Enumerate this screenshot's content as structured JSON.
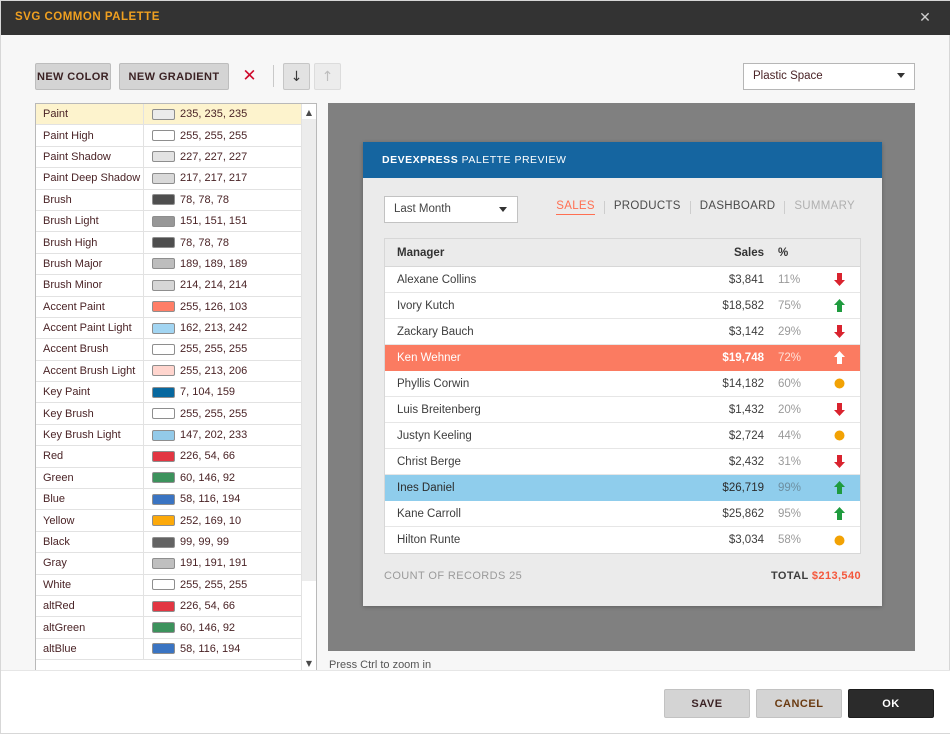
{
  "window": {
    "title": "SVG COMMON PALETTE",
    "close_icon": "close-icon",
    "accent_title_color": "#f0a020",
    "titlebar_color": "#333333"
  },
  "toolbar": {
    "new_color_label": "NEW COLOR",
    "new_gradient_label": "NEW GRADIENT",
    "delete_icon": "delete-x-icon",
    "delete_icon_glyph": "✕",
    "delete_icon_color": "#cf0a2c",
    "move_down_icon": "arrow-down-icon",
    "move_down_glyph": "↓",
    "move_up_icon": "arrow-up-icon",
    "move_up_glyph": "↑",
    "move_up_disabled": true
  },
  "palette_select": {
    "value": "Plastic Space",
    "caret_icon": "chevron-down-icon"
  },
  "palette_list": {
    "scroll_up_glyph": "▲",
    "scroll_down_glyph": "▼",
    "items": [
      {
        "name": "Paint",
        "value": "235, 235, 235",
        "color": "#ebebeb",
        "selected": true
      },
      {
        "name": "Paint High",
        "value": "255, 255, 255",
        "color": "#ffffff",
        "selected": false
      },
      {
        "name": "Paint Shadow",
        "value": "227, 227, 227",
        "color": "#e3e3e3",
        "selected": false
      },
      {
        "name": "Paint Deep Shadow",
        "value": "217, 217, 217",
        "color": "#d9d9d9",
        "selected": false
      },
      {
        "name": "Brush",
        "value": "78, 78, 78",
        "color": "#4e4e4e",
        "selected": false
      },
      {
        "name": "Brush Light",
        "value": "151, 151, 151",
        "color": "#979797",
        "selected": false
      },
      {
        "name": "Brush High",
        "value": "78, 78, 78",
        "color": "#4e4e4e",
        "selected": false
      },
      {
        "name": "Brush Major",
        "value": "189, 189, 189",
        "color": "#bdbdbd",
        "selected": false
      },
      {
        "name": "Brush Minor",
        "value": "214, 214, 214",
        "color": "#d6d6d6",
        "selected": false
      },
      {
        "name": "Accent Paint",
        "value": "255, 126, 103",
        "color": "#ff7e67",
        "selected": false
      },
      {
        "name": "Accent Paint Light",
        "value": "162, 213, 242",
        "color": "#a2d5f2",
        "selected": false
      },
      {
        "name": "Accent Brush",
        "value": "255, 255, 255",
        "color": "#ffffff",
        "selected": false
      },
      {
        "name": "Accent Brush Light",
        "value": "255, 213, 206",
        "color": "#ffd5ce",
        "selected": false
      },
      {
        "name": "Key Paint",
        "value": "7, 104, 159",
        "color": "#07689f",
        "selected": false
      },
      {
        "name": "Key Brush",
        "value": "255, 255, 255",
        "color": "#ffffff",
        "selected": false
      },
      {
        "name": "Key Brush Light",
        "value": "147, 202, 233",
        "color": "#93cae9",
        "selected": false
      },
      {
        "name": "Red",
        "value": "226, 54, 66",
        "color": "#e23642",
        "selected": false
      },
      {
        "name": "Green",
        "value": "60, 146, 92",
        "color": "#3c925c",
        "selected": false
      },
      {
        "name": "Blue",
        "value": "58, 116, 194",
        "color": "#3a74c2",
        "selected": false
      },
      {
        "name": "Yellow",
        "value": "252, 169, 10",
        "color": "#fca90a",
        "selected": false
      },
      {
        "name": "Black",
        "value": "99, 99, 99",
        "color": "#636363",
        "selected": false
      },
      {
        "name": "Gray",
        "value": "191, 191, 191",
        "color": "#bfbfbf",
        "selected": false
      },
      {
        "name": "White",
        "value": "255, 255, 255",
        "color": "#ffffff",
        "selected": false
      },
      {
        "name": "altRed",
        "value": "226, 54, 66",
        "color": "#e23642",
        "selected": false
      },
      {
        "name": "altGreen",
        "value": "60, 146, 92",
        "color": "#3c925c",
        "selected": false
      },
      {
        "name": "altBlue",
        "value": "58, 116, 194",
        "color": "#3a74c2",
        "selected": false
      }
    ]
  },
  "preview": {
    "frame_color": "#808080",
    "header_brand": "DEVEXPRESS",
    "header_title": "PALETTE PREVIEW",
    "header_color": "#1565a0",
    "period": {
      "value": "Last Month",
      "caret_icon": "chevron-down-icon"
    },
    "tabs": [
      {
        "label": "SALES",
        "state": "active"
      },
      {
        "label": "PRODUCTS",
        "state": "normal"
      },
      {
        "label": "DASHBOARD",
        "state": "normal"
      },
      {
        "label": "SUMMARY",
        "state": "muted"
      }
    ],
    "grid": {
      "columns": [
        "Manager",
        "Sales",
        "%"
      ],
      "rows": [
        {
          "manager": "Alexane Collins",
          "sales": "$3,841",
          "pct": "11%",
          "indicator": "down",
          "highlight": "none"
        },
        {
          "manager": "Ivory Kutch",
          "sales": "$18,582",
          "pct": "75%",
          "indicator": "up",
          "highlight": "none"
        },
        {
          "manager": "Zackary Bauch",
          "sales": "$3,142",
          "pct": "29%",
          "indicator": "down",
          "highlight": "none"
        },
        {
          "manager": "Ken Wehner",
          "sales": "$19,748",
          "pct": "72%",
          "indicator": "up-white",
          "highlight": "accent"
        },
        {
          "manager": "Phyllis Corwin",
          "sales": "$14,182",
          "pct": "60%",
          "indicator": "dot",
          "highlight": "none"
        },
        {
          "manager": "Luis Breitenberg",
          "sales": "$1,432",
          "pct": "20%",
          "indicator": "down",
          "highlight": "none"
        },
        {
          "manager": "Justyn Keeling",
          "sales": "$2,724",
          "pct": "44%",
          "indicator": "dot",
          "highlight": "none"
        },
        {
          "manager": "Christ Berge",
          "sales": "$2,432",
          "pct": "31%",
          "indicator": "down",
          "highlight": "none"
        },
        {
          "manager": "Ines Daniel",
          "sales": "$26,719",
          "pct": "99%",
          "indicator": "up",
          "highlight": "key"
        },
        {
          "manager": "Kane Carroll",
          "sales": "$25,862",
          "pct": "95%",
          "indicator": "up",
          "highlight": "none"
        },
        {
          "manager": "Hilton Runte",
          "sales": "$3,034",
          "pct": "58%",
          "indicator": "dot",
          "highlight": "none"
        }
      ]
    },
    "footer": {
      "count_label": "COUNT OF RECORDS 25",
      "total_label": "TOTAL",
      "total_value": "$213,540"
    }
  },
  "zoom_hint": "Press Ctrl to zoom in",
  "footer_buttons": {
    "save": "SAVE",
    "cancel": "CANCEL",
    "ok": "OK"
  }
}
